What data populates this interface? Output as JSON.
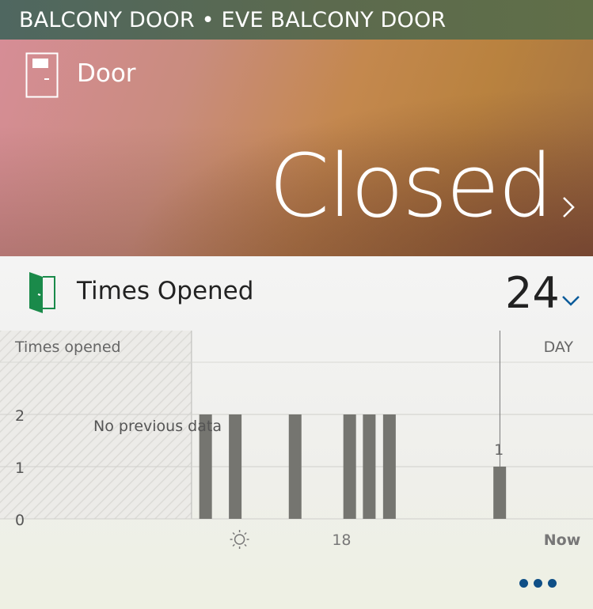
{
  "title": "BALCONY DOOR • EVE BALCONY DOOR",
  "hero": {
    "label": "Door",
    "status": "Closed",
    "icon": "door-icon",
    "chevron_icon": "chevron-right-icon"
  },
  "metric": {
    "label": "Times Opened",
    "value": "24",
    "icon": "open-door-icon",
    "chevron_icon": "chevron-down-icon",
    "accent_color": "#0b5b9a",
    "icon_color": "#1a8a4a"
  },
  "chart_data": {
    "type": "bar",
    "ylabel": "Times opened",
    "period_label": "DAY",
    "no_data_label": "No previous data",
    "y_ticks": [
      "0",
      "1",
      "2"
    ],
    "ylim": [
      0,
      3
    ],
    "x_ticks": [
      {
        "label": "sun-icon",
        "kind": "icon",
        "pos": 0.404
      },
      {
        "label": "18",
        "kind": "text",
        "pos": 0.576
      },
      {
        "label": "Now",
        "kind": "text",
        "pos": 0.948
      }
    ],
    "no_data_until": 0.323,
    "now_pos": 0.843,
    "bars": [
      {
        "pos": 0.336,
        "value": 2
      },
      {
        "pos": 0.386,
        "value": 2
      },
      {
        "pos": 0.487,
        "value": 2
      },
      {
        "pos": 0.579,
        "value": 2
      },
      {
        "pos": 0.612,
        "value": 2
      },
      {
        "pos": 0.646,
        "value": 2
      },
      {
        "pos": 0.832,
        "value": 1,
        "label": "1"
      }
    ],
    "bar_color": "#757570"
  },
  "footer": {
    "more_icon": "more-icon"
  }
}
